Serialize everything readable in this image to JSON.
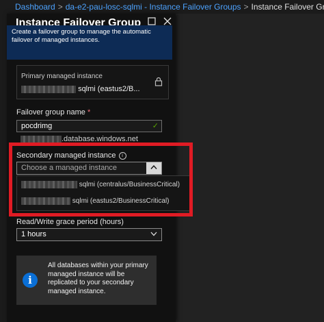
{
  "breadcrumb": {
    "items": [
      "Dashboard",
      "da-e2-pau-losc-sqlmi - Instance Failover Groups",
      "Instance Failover Group"
    ],
    "separator": ">"
  },
  "blade": {
    "title": "Instance Failover Group",
    "icons": {
      "maximize": "maximize-icon",
      "close": "close-icon"
    },
    "info_banner": "Create a failover group to manage the automatic failover of managed instances."
  },
  "primary": {
    "label": "Primary managed instance",
    "value_suffix": "sqlmi (eastus2/B...",
    "icon": "lock-icon"
  },
  "failover_group": {
    "label": "Failover group name",
    "required_mark": "*",
    "value": "pocdrimg",
    "domain_suffix": ".database.windows.net"
  },
  "secondary": {
    "label": "Secondary managed instance",
    "placeholder": "Choose a managed instance",
    "options": [
      "sqlmi (centralus/BusinessCritical)",
      "sqlmi (eastus2/BusinessCritical)"
    ]
  },
  "grace_period": {
    "label": "Read/Write grace period (hours)",
    "value": "1 hours"
  },
  "notice": {
    "text": "All databases within your primary managed instance will be replicated to your secondary managed instance.",
    "icon": "info-icon"
  },
  "colors": {
    "accent": "#4da3ff",
    "highlight_box": "#e01b24",
    "info_banner_bg": "#0d2b55",
    "notice_icon": "#0a6fd6"
  }
}
